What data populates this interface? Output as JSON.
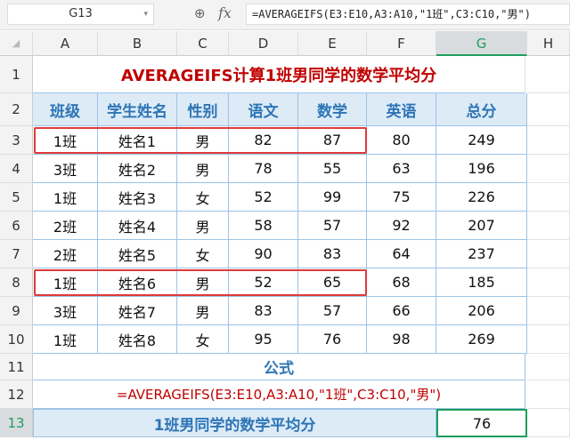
{
  "formula_bar": {
    "name_box": "G13",
    "formula": "=AVERAGEIFS(E3:E10,A3:A10,\"1班\",C3:C10,\"男\")"
  },
  "columns": [
    "A",
    "B",
    "C",
    "D",
    "E",
    "F",
    "G",
    "H"
  ],
  "rows": [
    "1",
    "2",
    "3",
    "4",
    "5",
    "6",
    "7",
    "8",
    "9",
    "10",
    "11",
    "12",
    "13"
  ],
  "title": "AVERAGEIFS计算1班男同学的数学平均分",
  "headers": [
    "班级",
    "学生姓名",
    "性别",
    "语文",
    "数学",
    "英语",
    "总分"
  ],
  "data": [
    [
      "1班",
      "姓名1",
      "男",
      "82",
      "87",
      "80",
      "249"
    ],
    [
      "3班",
      "姓名2",
      "男",
      "78",
      "55",
      "63",
      "196"
    ],
    [
      "1班",
      "姓名3",
      "女",
      "52",
      "99",
      "75",
      "226"
    ],
    [
      "2班",
      "姓名4",
      "男",
      "58",
      "57",
      "92",
      "207"
    ],
    [
      "2班",
      "姓名5",
      "女",
      "90",
      "83",
      "64",
      "237"
    ],
    [
      "1班",
      "姓名6",
      "男",
      "52",
      "65",
      "68",
      "185"
    ],
    [
      "3班",
      "姓名7",
      "男",
      "83",
      "57",
      "66",
      "206"
    ],
    [
      "1班",
      "姓名8",
      "女",
      "95",
      "76",
      "98",
      "269"
    ]
  ],
  "formula_label": "公式",
  "formula_text": "=AVERAGEIFS(E3:E10,A3:A10,\"1班\",C3:C10,\"男\")",
  "result_label": "1班男同学的数学平均分",
  "result_value": "76",
  "colors": {
    "title": "#c00000",
    "header": "#2e75b6",
    "header_bg": "#ddebf7",
    "highlight": "#e03a3a",
    "selection": "#1e9e5c"
  }
}
